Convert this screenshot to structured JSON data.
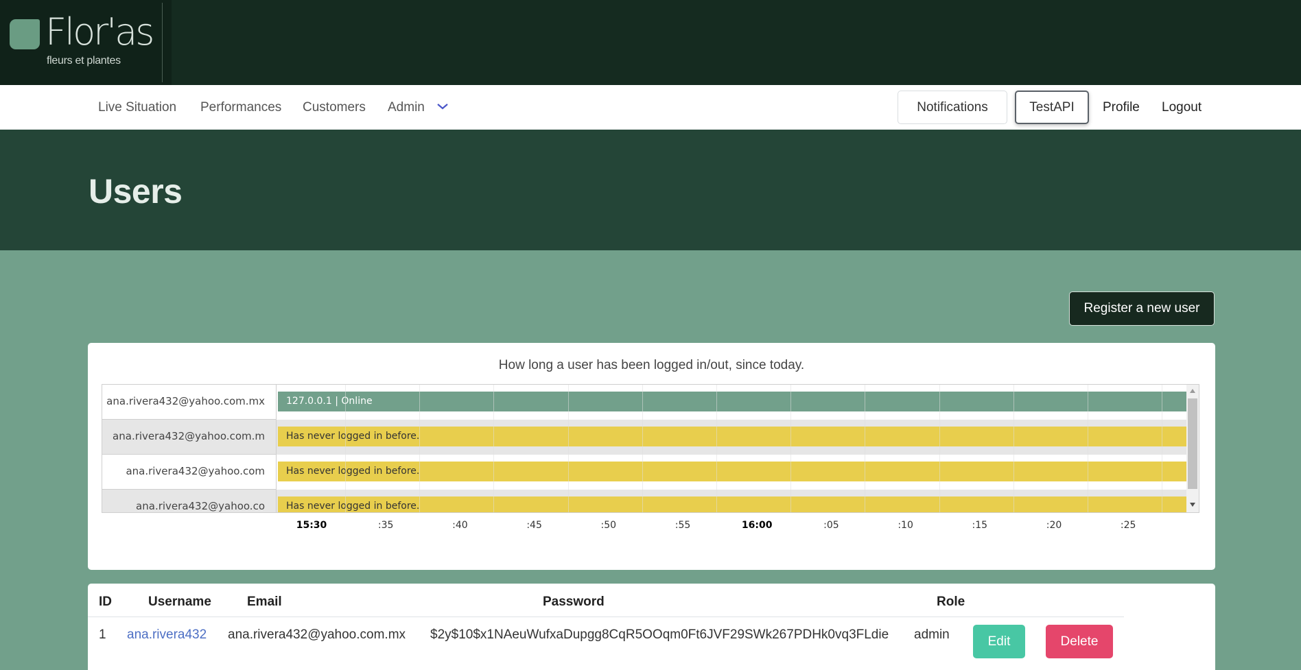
{
  "brand": {
    "name": "Flor'as",
    "tagline": "fleurs et plantes"
  },
  "nav": {
    "left": [
      {
        "label": "Live Situation"
      },
      {
        "label": "Performances"
      },
      {
        "label": "Customers"
      },
      {
        "label": "Admin",
        "icon": "chevron-down-icon"
      }
    ],
    "right": [
      {
        "label": "Notifications"
      },
      {
        "label": "TestAPI",
        "active": true
      },
      {
        "label": "Profile"
      },
      {
        "label": "Logout"
      }
    ]
  },
  "header": {
    "title": "Users"
  },
  "actions": {
    "register_label": "Register a new user"
  },
  "timeline": {
    "title": "How long a user has been logged in/out, since today.",
    "rows": [
      {
        "label": "ana.rivera432@yahoo.com.mx",
        "bar": "127.0.0.1 | Online",
        "color": "#72a08b",
        "text_color": "#ffffff"
      },
      {
        "label": "ana.rivera432@yahoo.com.m",
        "bar": "Has never logged in before.",
        "color": "#e8ce4d",
        "text_color": "#333333"
      },
      {
        "label": "ana.rivera432@yahoo.com",
        "bar": "Has never logged in before.",
        "color": "#e8ce4d",
        "text_color": "#333333"
      },
      {
        "label": "ana.rivera432@yahoo.co",
        "bar": "Has never logged in before.",
        "color": "#e8ce4d",
        "text_color": "#333333"
      }
    ],
    "ticks": [
      {
        "label": "15:30",
        "major": true
      },
      {
        "label": ":35"
      },
      {
        "label": ":40"
      },
      {
        "label": ":45"
      },
      {
        "label": ":50"
      },
      {
        "label": ":55"
      },
      {
        "label": "16:00",
        "major": true
      },
      {
        "label": ":05"
      },
      {
        "label": ":10"
      },
      {
        "label": ":15"
      },
      {
        "label": ":20"
      },
      {
        "label": ":25"
      }
    ]
  },
  "users_table": {
    "headers": {
      "id": "ID",
      "username": "Username",
      "email": "Email",
      "password": "Password",
      "role": "Role"
    },
    "rows": [
      {
        "id": "1",
        "username": "ana.rivera432",
        "email": "ana.rivera432@yahoo.com.mx",
        "password": "$2y$10$x1NAeuWufxaDupgg8CqR5OOqm0Ft6JVF29SWk267PDHk0vq3FLdie",
        "role": "admin",
        "edit_label": "Edit",
        "delete_label": "Delete"
      }
    ]
  },
  "colors": {
    "brand_dark": "#152b20",
    "header_band": "#244537",
    "page_bg": "#72a08b",
    "online_bar": "#72a08b",
    "offline_bar": "#e8ce4d",
    "edit_button": "#48c7a4",
    "delete_button": "#e5466b",
    "link": "#4d6fc4"
  }
}
